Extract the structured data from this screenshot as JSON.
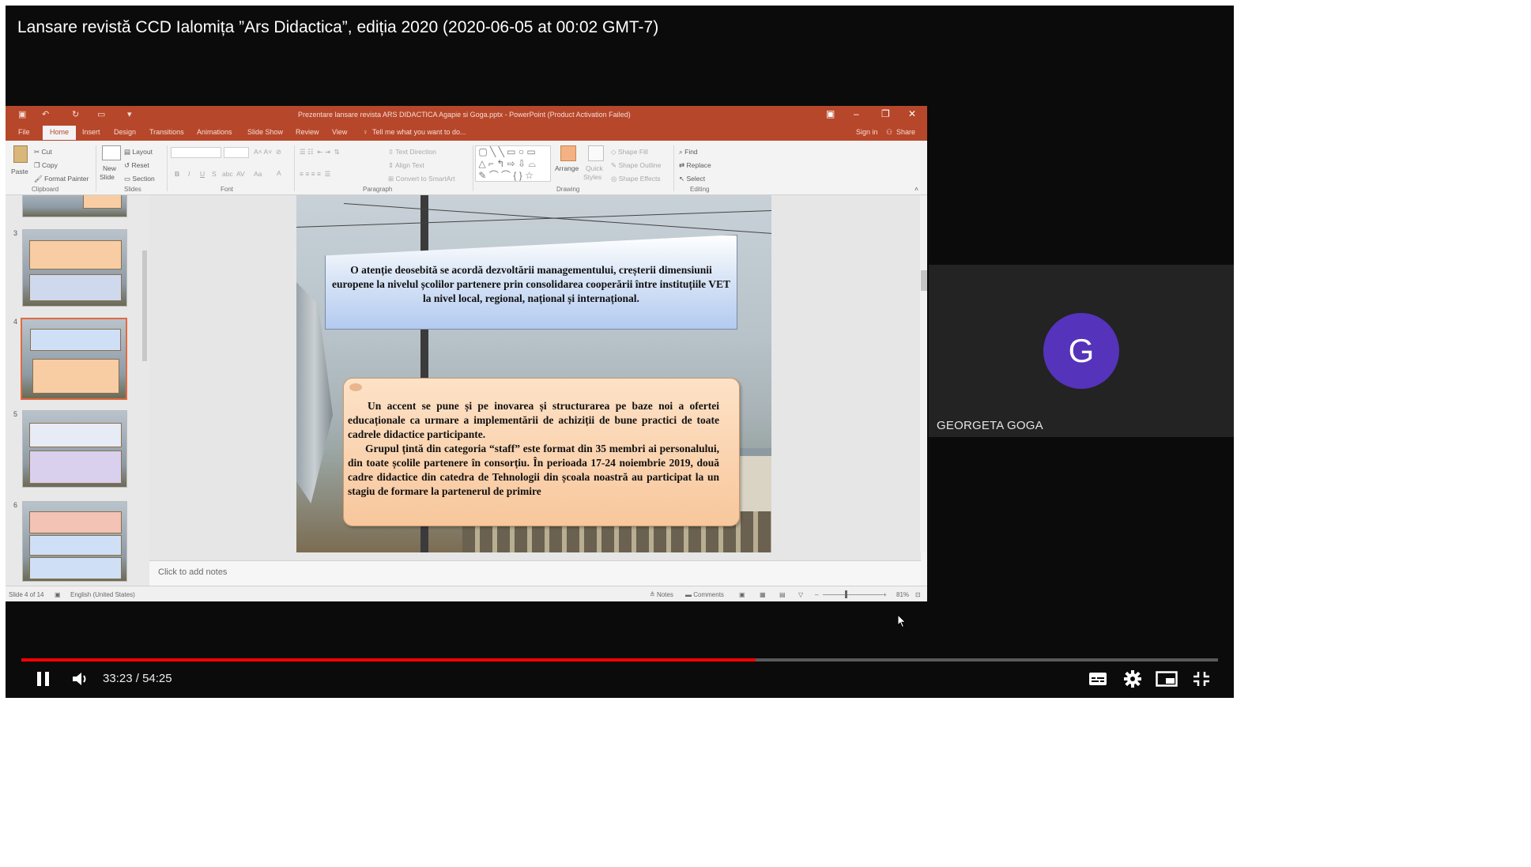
{
  "video": {
    "title": "Lansare revistă CCD Ialomița ”Ars Didactica”, ediția 2020 (2020-06-05 at 00:02 GMT-7)",
    "time_current": "33:23",
    "time_total": "54:25",
    "time_sep": "/",
    "progress_fraction": 0.6136
  },
  "powerpoint": {
    "window_title": "Prezentare lansare revista ARS  DIDACTICA Agapie si  Goga.pptx - PowerPoint (Product Activation Failed)",
    "tabs": [
      "File",
      "Home",
      "Insert",
      "Design",
      "Transitions",
      "Animations",
      "Slide Show",
      "Review",
      "View"
    ],
    "tell_me": "Tell me what you want to do...",
    "sign_in": "Sign in",
    "share": "Share",
    "ribbon": {
      "clipboard": {
        "paste": "Paste",
        "cut": "Cut",
        "copy": "Copy",
        "format_painter": "Format Painter",
        "label": "Clipboard"
      },
      "slides": {
        "new_slide_1": "New",
        "new_slide_2": "Slide",
        "layout": "Layout",
        "reset": "Reset",
        "section": "Section",
        "label": "Slides"
      },
      "font": {
        "label": "Font"
      },
      "paragraph": {
        "text_direction": "Text Direction",
        "align_text": "Align Text",
        "convert_smartart": "Convert to SmartArt",
        "label": "Paragraph"
      },
      "drawing": {
        "arrange": "Arrange",
        "quick_styles_1": "Quick",
        "quick_styles_2": "Styles",
        "shape_fill": "Shape Fill",
        "shape_outline": "Shape Outline",
        "shape_effects": "Shape Effects",
        "label": "Drawing"
      },
      "editing": {
        "find": "Find",
        "replace": "Replace",
        "select": "Select",
        "label": "Editing"
      }
    },
    "thumbnails": [
      "3",
      "4",
      "5",
      "6"
    ],
    "slide": {
      "box1_text": "O atenție deosebită se acordă dezvoltării managementului, creșterii dimensiunii europene la nivelul școlilor partenere prin consolidarea cooperării între instituțiile VET la nivel local, regional, național și internațional.",
      "box2_para1": "Un accent se pune și pe inovarea și structurarea pe baze noi a ofertei educaționale ca urmare a implementării de achiziții de bune practici de toate cadrele didactice participante.",
      "box2_para2": "Grupul țintă din categoria “staff” este format din 35 membri ai personalului, din toate școlile partenere în consorțiu. În perioada 17-24 noiembrie 2019, două cadre didactice din catedra de Tehnologii din școala noastră au participat la un stagiu de formare la partenerul de primire"
    },
    "notes_placeholder": "Click to add notes",
    "status": {
      "slide_of": "Slide 4 of 14",
      "language": "English (United States)",
      "notes": "Notes",
      "comments": "Comments",
      "zoom": "81%"
    }
  },
  "participant": {
    "initial": "G",
    "name": "GEORGETA GOGA"
  }
}
